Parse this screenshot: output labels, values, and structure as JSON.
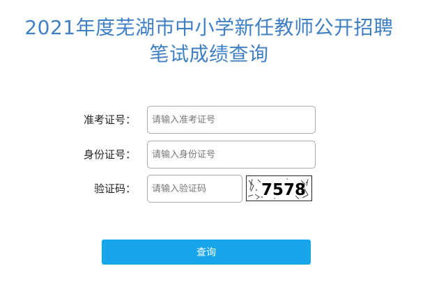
{
  "header": {
    "title_line1": "2021年度芜湖市中小学新任教师公开招聘",
    "title_line2": "笔试成绩查询"
  },
  "form": {
    "admission_no": {
      "label": "准考证号：",
      "placeholder": "请输入准考证号",
      "value": ""
    },
    "id_no": {
      "label": "身份证号：",
      "placeholder": "请输入身份证号",
      "value": ""
    },
    "captcha": {
      "label": "验证码：",
      "placeholder": "请输入验证码",
      "value": "",
      "image_text": "7578"
    },
    "submit_label": "查询"
  },
  "colors": {
    "title": "#3f7fc4",
    "button": "#18a6ea",
    "button_text": "#ffffff",
    "input_border": "#a9a9a9"
  }
}
